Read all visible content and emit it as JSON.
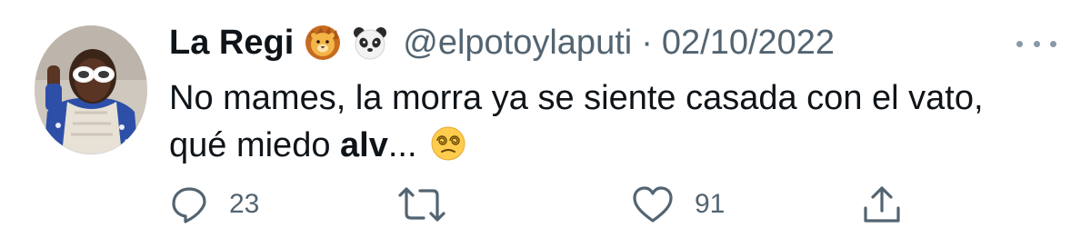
{
  "tweet": {
    "display_name": "La Regi",
    "emojis": [
      "lion-face",
      "panda-face"
    ],
    "handle": "@elpotoylaputi",
    "separator": "·",
    "date": "02/10/2022",
    "text_line1": "No mames, la morra ya se siente casada con el vato,",
    "text_line2_prefix": "qué miedo ",
    "text_bold": "alv",
    "text_suffix": "...",
    "text_emoji": "face-with-spiral-eyes"
  },
  "actions": {
    "reply_count": "23",
    "retweet_count": "",
    "like_count": "91"
  },
  "colors": {
    "text": "#0f1419",
    "secondary": "#536471",
    "background": "#ffffff"
  }
}
